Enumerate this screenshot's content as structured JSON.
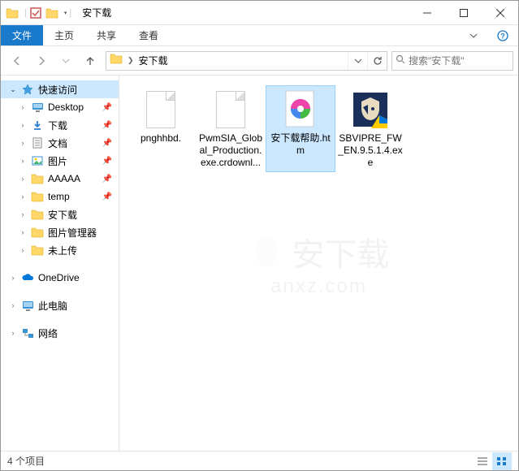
{
  "window": {
    "title": "安下载",
    "qat_divider": "|"
  },
  "ribbon": {
    "file": "文件",
    "home": "主页",
    "share": "共享",
    "view": "查看"
  },
  "address": {
    "crumb": "安下载",
    "search_placeholder": "搜索\"安下载\""
  },
  "sidebar": {
    "quick_access": "快速访问",
    "items": [
      {
        "label": "Desktop",
        "pinned": true,
        "icon": "desktop"
      },
      {
        "label": "下载",
        "pinned": true,
        "icon": "downloads"
      },
      {
        "label": "文档",
        "pinned": true,
        "icon": "documents"
      },
      {
        "label": "图片",
        "pinned": true,
        "icon": "pictures"
      },
      {
        "label": "AAAAA",
        "pinned": true,
        "icon": "folder"
      },
      {
        "label": "temp",
        "pinned": true,
        "icon": "folder"
      },
      {
        "label": "安下载",
        "pinned": false,
        "icon": "folder"
      },
      {
        "label": "图片管理器",
        "pinned": false,
        "icon": "folder"
      },
      {
        "label": "未上传",
        "pinned": false,
        "icon": "folder"
      }
    ],
    "onedrive": "OneDrive",
    "thispc": "此电脑",
    "network": "网络"
  },
  "files": [
    {
      "name": "pnghhbd.",
      "type": "blank",
      "selected": false
    },
    {
      "name": "PwmSIA_Global_Production.exe.crdownl...",
      "type": "blank",
      "selected": false
    },
    {
      "name": "安下载帮助.htm",
      "type": "htm",
      "selected": true
    },
    {
      "name": "SBVIPRE_FW_EN.9.5.1.4.exe",
      "type": "exe-shield",
      "selected": false
    }
  ],
  "status": {
    "count": "4 个项目"
  },
  "watermark": {
    "line1": "安下载",
    "line2": "anxz.com"
  }
}
